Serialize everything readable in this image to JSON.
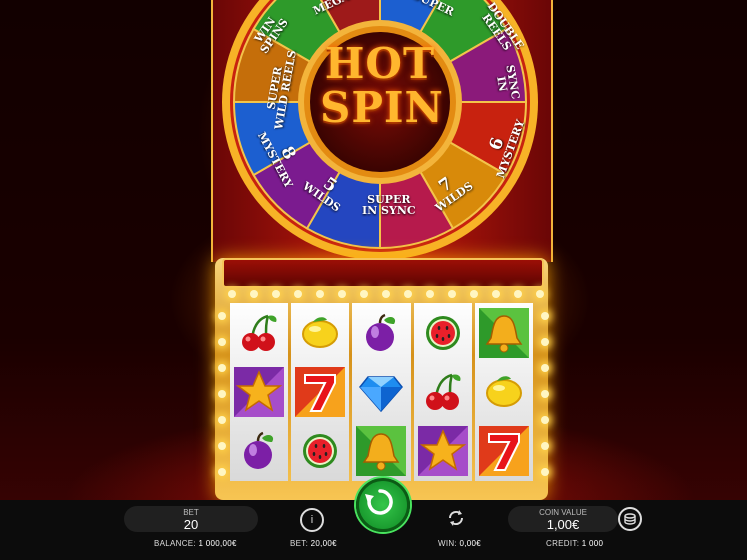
{
  "wheel": {
    "center": "HOT SPIN",
    "segments": [
      {
        "top": "WIN",
        "bottom": "SPINS"
      },
      {
        "top": "",
        "bottom": "MEGA"
      },
      {
        "top": "",
        "bottom": "SUPER"
      },
      {
        "top": "DOUBLE",
        "bottom": "REELS"
      },
      {
        "top": "SYNC",
        "bottom": "IN"
      },
      {
        "top": "6",
        "bottom": "MYSTERY"
      },
      {
        "top": "7",
        "bottom": "WILDS"
      },
      {
        "top": "SUPER",
        "bottom": "IN SYNC"
      },
      {
        "top": "5",
        "bottom": "WILDS"
      },
      {
        "top": "8",
        "bottom": "MYSTERY"
      },
      {
        "top": "SUPER",
        "bottom": "WILD REELS"
      }
    ]
  },
  "reels": [
    [
      "cherry",
      "star",
      "plum"
    ],
    [
      "lemon",
      "seven",
      "watermelon"
    ],
    [
      "plum",
      "diamond",
      "bell"
    ],
    [
      "watermelon",
      "cherry",
      "star"
    ],
    [
      "bell",
      "lemon",
      "seven"
    ]
  ],
  "colors": {
    "spin": "#1ea834",
    "gold": "#f3b43b",
    "red": "#c81b0d"
  },
  "hud": {
    "bet_label": "BET",
    "bet_value": "20",
    "coin_label": "COIN VALUE",
    "coin_value": "1,00€",
    "info_icon": "info-icon",
    "autoplay_icon": "autoplay-icon",
    "coins_icon": "coins-icon",
    "spin_icon": "spin-arrow-icon"
  },
  "status": {
    "balance_label": "BALANCE:",
    "balance_value": "1 000,00€",
    "bet_label": "BET:",
    "bet_value": "20,00€",
    "win_label": "WIN:",
    "win_value": "0,00€",
    "credit_label": "CREDIT:",
    "credit_value": "1 000"
  }
}
